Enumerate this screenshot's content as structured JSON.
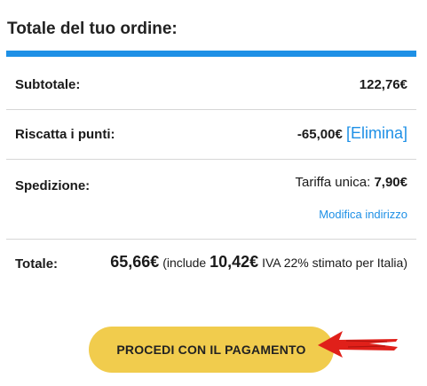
{
  "title": "Totale del tuo ordine:",
  "subtotal": {
    "label": "Subtotale:",
    "value": "122,76€"
  },
  "redeem": {
    "label": "Riscatta i punti:",
    "amount": "-65,00€",
    "remove_link": "[Elimina]"
  },
  "shipping": {
    "label": "Spedizione:",
    "rate_label": "Tariffa unica:",
    "rate_value": "7,90€",
    "change_address": "Modifica indirizzo"
  },
  "total": {
    "label": "Totale:",
    "value": "65,66€",
    "vat_prefix": "(include",
    "vat_amount": "10,42€",
    "vat_suffix": "IVA 22% stimato per Italia)"
  },
  "checkout_button": "PROCEDI CON IL PAGAMENTO",
  "colors": {
    "accent_blue": "#1e90e6",
    "button_yellow": "#f1cc4d",
    "arrow_red": "#e0201a"
  }
}
